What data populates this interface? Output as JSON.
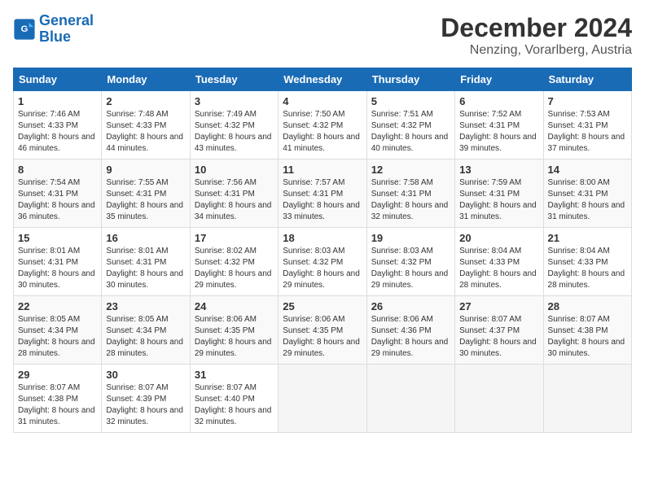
{
  "header": {
    "logo_line1": "General",
    "logo_line2": "Blue",
    "month": "December 2024",
    "location": "Nenzing, Vorarlberg, Austria"
  },
  "weekdays": [
    "Sunday",
    "Monday",
    "Tuesday",
    "Wednesday",
    "Thursday",
    "Friday",
    "Saturday"
  ],
  "weeks": [
    [
      {
        "day": 1,
        "sunrise": "7:46 AM",
        "sunset": "4:33 PM",
        "daylight": "8 hours and 46 minutes."
      },
      {
        "day": 2,
        "sunrise": "7:48 AM",
        "sunset": "4:33 PM",
        "daylight": "8 hours and 44 minutes."
      },
      {
        "day": 3,
        "sunrise": "7:49 AM",
        "sunset": "4:32 PM",
        "daylight": "8 hours and 43 minutes."
      },
      {
        "day": 4,
        "sunrise": "7:50 AM",
        "sunset": "4:32 PM",
        "daylight": "8 hours and 41 minutes."
      },
      {
        "day": 5,
        "sunrise": "7:51 AM",
        "sunset": "4:32 PM",
        "daylight": "8 hours and 40 minutes."
      },
      {
        "day": 6,
        "sunrise": "7:52 AM",
        "sunset": "4:31 PM",
        "daylight": "8 hours and 39 minutes."
      },
      {
        "day": 7,
        "sunrise": "7:53 AM",
        "sunset": "4:31 PM",
        "daylight": "8 hours and 37 minutes."
      }
    ],
    [
      {
        "day": 8,
        "sunrise": "7:54 AM",
        "sunset": "4:31 PM",
        "daylight": "8 hours and 36 minutes."
      },
      {
        "day": 9,
        "sunrise": "7:55 AM",
        "sunset": "4:31 PM",
        "daylight": "8 hours and 35 minutes."
      },
      {
        "day": 10,
        "sunrise": "7:56 AM",
        "sunset": "4:31 PM",
        "daylight": "8 hours and 34 minutes."
      },
      {
        "day": 11,
        "sunrise": "7:57 AM",
        "sunset": "4:31 PM",
        "daylight": "8 hours and 33 minutes."
      },
      {
        "day": 12,
        "sunrise": "7:58 AM",
        "sunset": "4:31 PM",
        "daylight": "8 hours and 32 minutes."
      },
      {
        "day": 13,
        "sunrise": "7:59 AM",
        "sunset": "4:31 PM",
        "daylight": "8 hours and 31 minutes."
      },
      {
        "day": 14,
        "sunrise": "8:00 AM",
        "sunset": "4:31 PM",
        "daylight": "8 hours and 31 minutes."
      }
    ],
    [
      {
        "day": 15,
        "sunrise": "8:01 AM",
        "sunset": "4:31 PM",
        "daylight": "8 hours and 30 minutes."
      },
      {
        "day": 16,
        "sunrise": "8:01 AM",
        "sunset": "4:31 PM",
        "daylight": "8 hours and 30 minutes."
      },
      {
        "day": 17,
        "sunrise": "8:02 AM",
        "sunset": "4:32 PM",
        "daylight": "8 hours and 29 minutes."
      },
      {
        "day": 18,
        "sunrise": "8:03 AM",
        "sunset": "4:32 PM",
        "daylight": "8 hours and 29 minutes."
      },
      {
        "day": 19,
        "sunrise": "8:03 AM",
        "sunset": "4:32 PM",
        "daylight": "8 hours and 29 minutes."
      },
      {
        "day": 20,
        "sunrise": "8:04 AM",
        "sunset": "4:33 PM",
        "daylight": "8 hours and 28 minutes."
      },
      {
        "day": 21,
        "sunrise": "8:04 AM",
        "sunset": "4:33 PM",
        "daylight": "8 hours and 28 minutes."
      }
    ],
    [
      {
        "day": 22,
        "sunrise": "8:05 AM",
        "sunset": "4:34 PM",
        "daylight": "8 hours and 28 minutes."
      },
      {
        "day": 23,
        "sunrise": "8:05 AM",
        "sunset": "4:34 PM",
        "daylight": "8 hours and 28 minutes."
      },
      {
        "day": 24,
        "sunrise": "8:06 AM",
        "sunset": "4:35 PM",
        "daylight": "8 hours and 29 minutes."
      },
      {
        "day": 25,
        "sunrise": "8:06 AM",
        "sunset": "4:35 PM",
        "daylight": "8 hours and 29 minutes."
      },
      {
        "day": 26,
        "sunrise": "8:06 AM",
        "sunset": "4:36 PM",
        "daylight": "8 hours and 29 minutes."
      },
      {
        "day": 27,
        "sunrise": "8:07 AM",
        "sunset": "4:37 PM",
        "daylight": "8 hours and 30 minutes."
      },
      {
        "day": 28,
        "sunrise": "8:07 AM",
        "sunset": "4:38 PM",
        "daylight": "8 hours and 30 minutes."
      }
    ],
    [
      {
        "day": 29,
        "sunrise": "8:07 AM",
        "sunset": "4:38 PM",
        "daylight": "8 hours and 31 minutes."
      },
      {
        "day": 30,
        "sunrise": "8:07 AM",
        "sunset": "4:39 PM",
        "daylight": "8 hours and 32 minutes."
      },
      {
        "day": 31,
        "sunrise": "8:07 AM",
        "sunset": "4:40 PM",
        "daylight": "8 hours and 32 minutes."
      },
      null,
      null,
      null,
      null
    ]
  ]
}
